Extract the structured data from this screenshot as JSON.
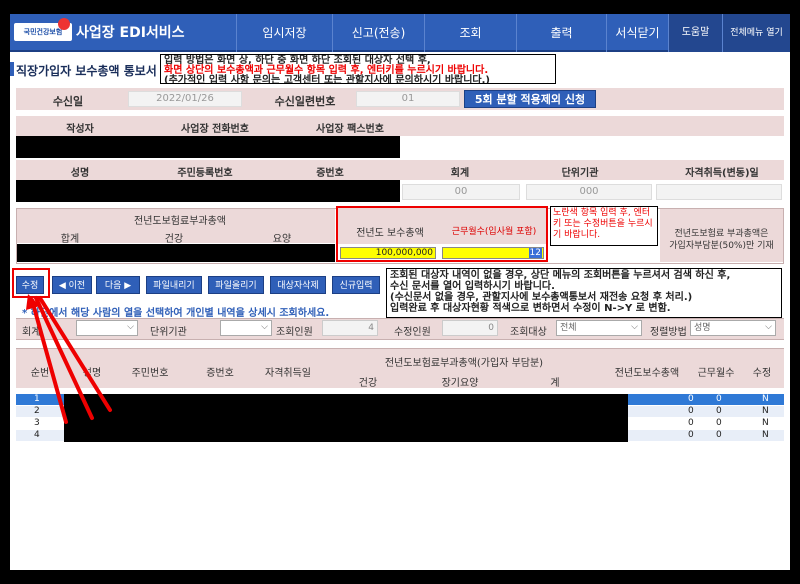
{
  "header": {
    "logo_text": "국민건강보험",
    "app_title": "사업장 EDI서비스",
    "menus": [
      "임시저장",
      "신고(전송)",
      "조회",
      "출력",
      "서식닫기",
      "도움말",
      "전체메뉴 열기"
    ]
  },
  "page_title": "직장가입자 보수총액 통보서",
  "help_text": {
    "line1": "입력 방법은 화면 상, 하단 중 화면 하단 조회된 대상자 선택 후,",
    "line2": "화면 상단의 보수총액과 근무월수 항목 입력 후, 엔터키를 누르시기 바랍니다.",
    "line3": "(추가적인 입력 사항 문의는 고객센터 또는 관할지사에 문의하시기 바랍니다.)"
  },
  "form": {
    "receive_date_label": "수신일",
    "receive_date_value": "2022/01/26",
    "receive_serial_label": "수신일련번호",
    "receive_serial_value": "01",
    "apply_button": "5회 분할 적용제외 신청",
    "header_row1": [
      "작성자",
      "사업장 전화번호",
      "사업장 팩스번호"
    ],
    "header_row2": [
      "성명",
      "주민등록번호",
      "증번호",
      "회계",
      "단위기관",
      "자격취득(변동)일"
    ],
    "account_value": "00",
    "unit_value": "000"
  },
  "panel": {
    "prev_year_total_label": "전년도보험료부과총액",
    "sub_labels": [
      "합계",
      "건강",
      "요양"
    ],
    "salary_total_label": "전년도 보수총액",
    "work_months_label": "근무월수(입사월 포함)",
    "salary_total_value": "100,000,000",
    "work_months_value": "12",
    "note": "노란색 항목 입력 후, 엔터키 또는 수정버튼을 누르시기 바랍니다.",
    "right_label1": "전년도보험료 부과총액은",
    "right_label2": "가입자부담분(50%)만 기재"
  },
  "toolbar": {
    "buttons": [
      "수정",
      "◀ 이전",
      "다음 ▶",
      "파일내리기",
      "파일올리기",
      "대상자삭제",
      "신규입력"
    ],
    "right_note": {
      "line1": "조회된 대상자 내역이 없을 경우, 상단 메뉴의 조회버튼을 누르셔서 검색 하신 후,",
      "line2": "수신 문서를 열어 입력하시기 바랍니다.",
      "line3": "(수신문서 없을 경우, 관할지사에 보수총액통보서 재전송 요청 후 처리.)",
      "line4": "입력완료 후 대상자현황 적색으로 변하면서 수정이 N->Y 로 변함."
    },
    "blue_note": "* 하단에서 해당 사람의 열을 선택하여 개인별 내역을 상세시 조회하세요."
  },
  "filter": {
    "account_label": "회계",
    "unit_label": "단위기관",
    "lookup_count_label": "조회인원",
    "lookup_count_value": "4",
    "edit_count_label": "수정인원",
    "edit_count_value": "0",
    "target_label": "조회대상",
    "target_value": "전체",
    "sort_label": "정렬방법",
    "sort_value": "성명"
  },
  "table": {
    "headers": [
      "순번",
      "성명",
      "주민번호",
      "증번호",
      "자격취득일",
      "전년도보험료부과총액(가입자 부담분)",
      "건강",
      "장기요양",
      "계",
      "전년도보수총액",
      "근무월수",
      "수정"
    ],
    "rows": [
      {
        "no": "1",
        "salary": "0",
        "months": "0",
        "edit": "N"
      },
      {
        "no": "2",
        "salary": "0",
        "months": "0",
        "edit": "N"
      },
      {
        "no": "3",
        "salary": "0",
        "months": "0",
        "edit": "N"
      },
      {
        "no": "4",
        "salary": "0",
        "months": "0",
        "edit": "N"
      }
    ]
  },
  "colors": {
    "primary": "#2f5fb8",
    "label_bg": "#ecd9d9",
    "highlight": "#ffff00",
    "annotation": "#e00000"
  }
}
